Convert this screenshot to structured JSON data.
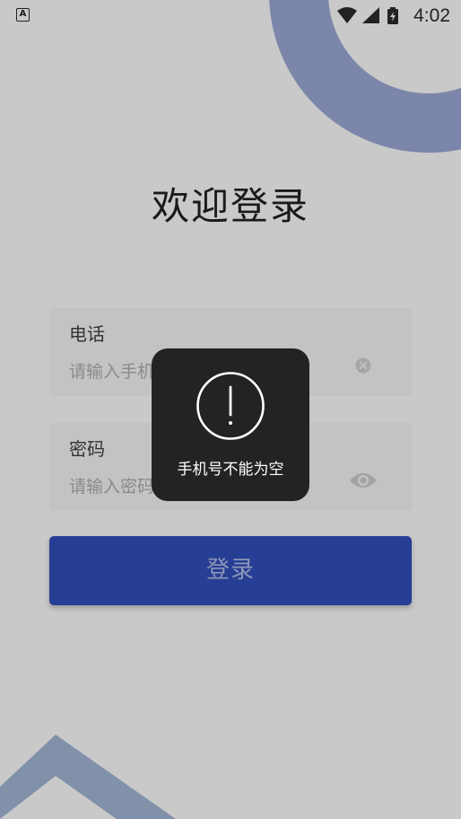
{
  "status_bar": {
    "app_icon": "font-a-icon",
    "icons": [
      "wifi-icon",
      "cellular-signal-icon",
      "battery-charging-icon"
    ],
    "time": "4:02"
  },
  "login": {
    "title": "欢迎登录",
    "phone": {
      "label": "电话",
      "placeholder": "请输入手机号码",
      "value": "",
      "clear_icon": "clear-circle-icon"
    },
    "password": {
      "label": "密码",
      "placeholder": "请输入密码",
      "value": "",
      "toggle_icon": "eye-icon"
    },
    "submit_label": "登录"
  },
  "toast": {
    "icon": "exclamation-circle-icon",
    "message": "手机号不能为空"
  },
  "colors": {
    "primary_button": "#263f94",
    "background_overlay": "#c9c9c9",
    "toast_background": "#232323",
    "decoration": "#7b86aa"
  }
}
